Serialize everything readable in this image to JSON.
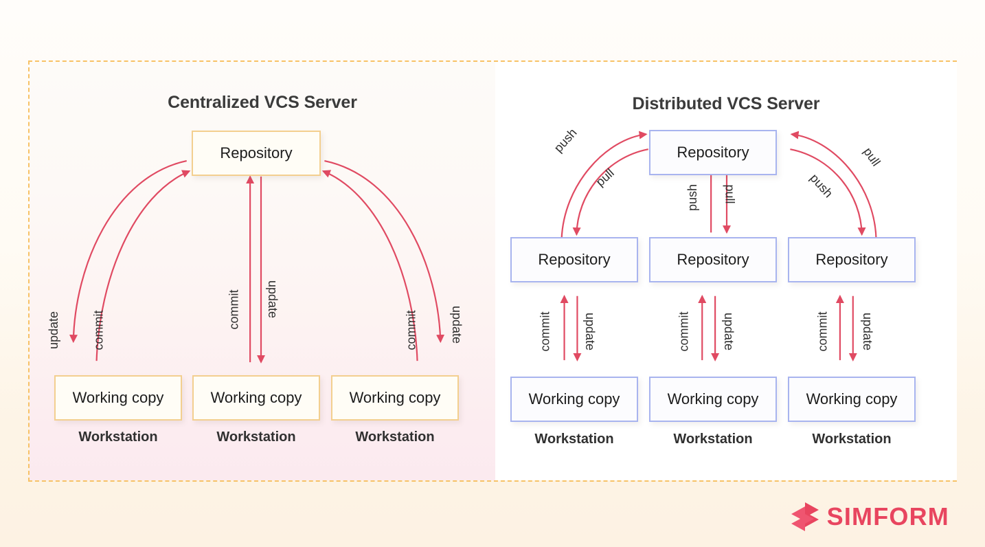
{
  "theme": {
    "page_bg": "#fdf4e7",
    "frame_border": "#f7c266",
    "arrow_color": "#e04a62",
    "cream_border": "#f3cf8f",
    "cream_fill": "#fffdf6",
    "blue_border": "#a8b4ef",
    "blue_fill": "#fcfcfe",
    "title_color": "#3b3b3b",
    "brand_color": "#e8455f"
  },
  "left_panel": {
    "title": "Centralized VCS Server",
    "server_repo": "Repository",
    "workstations": [
      {
        "box": "Working copy",
        "label": "Workstation"
      },
      {
        "box": "Working copy",
        "label": "Workstation"
      },
      {
        "box": "Working copy",
        "label": "Workstation"
      }
    ],
    "edges": [
      {
        "name": "left-update",
        "label": "update"
      },
      {
        "name": "left-commit",
        "label": "commit"
      },
      {
        "name": "center-commit",
        "label": "commit"
      },
      {
        "name": "center-update",
        "label": "update"
      },
      {
        "name": "right-commit",
        "label": "commit"
      },
      {
        "name": "right-update",
        "label": "update"
      }
    ]
  },
  "right_panel": {
    "title": "Distributed VCS Server",
    "server_repo": "Repository",
    "local_repos": [
      "Repository",
      "Repository",
      "Repository"
    ],
    "workstations": [
      {
        "box": "Working copy",
        "label": "Workstation"
      },
      {
        "box": "Working copy",
        "label": "Workstation"
      },
      {
        "box": "Working copy",
        "label": "Workstation"
      }
    ],
    "server_edges": [
      {
        "name": "left-push",
        "label": "push"
      },
      {
        "name": "left-pull",
        "label": "pull"
      },
      {
        "name": "center-push",
        "label": "push"
      },
      {
        "name": "center-pull",
        "label": "pull"
      },
      {
        "name": "right-push",
        "label": "push"
      },
      {
        "name": "right-pull",
        "label": "pull"
      }
    ],
    "local_edges": [
      {
        "name": "col1-commit",
        "label": "commit"
      },
      {
        "name": "col1-update",
        "label": "update"
      },
      {
        "name": "col2-commit",
        "label": "commit"
      },
      {
        "name": "col2-update",
        "label": "update"
      },
      {
        "name": "col3-commit",
        "label": "commit"
      },
      {
        "name": "col3-update",
        "label": "update"
      }
    ]
  },
  "brand": {
    "name": "SIMFORM"
  }
}
